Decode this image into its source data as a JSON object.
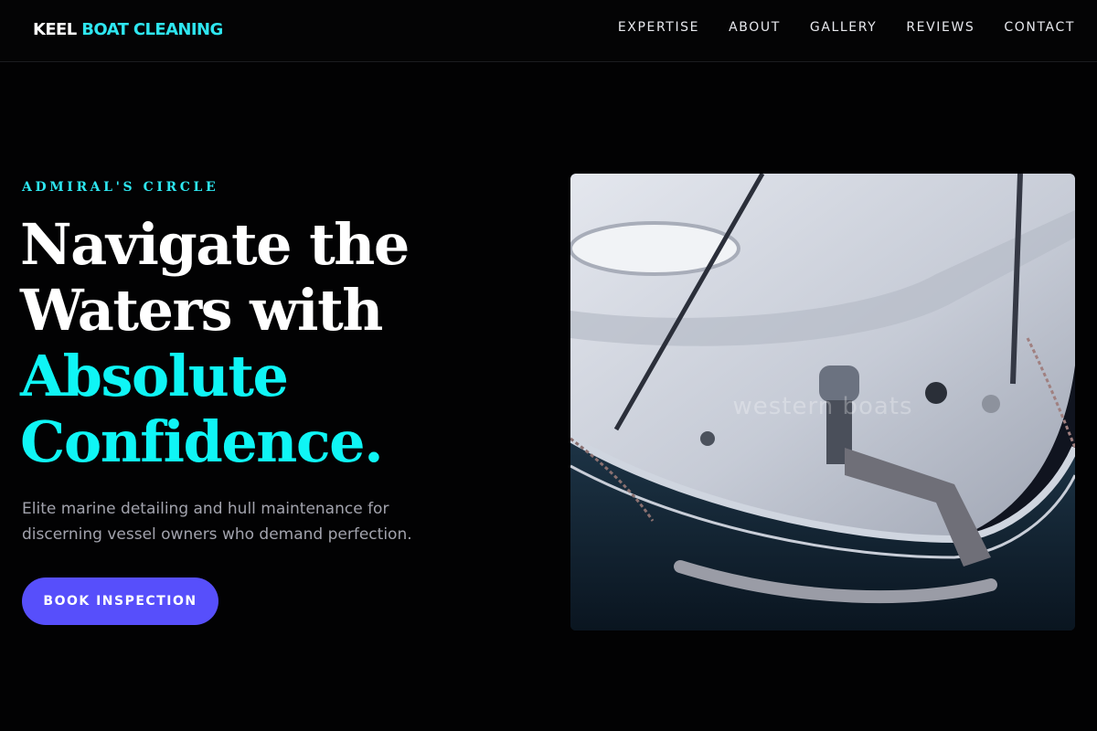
{
  "header": {
    "logo_word": "KEEL",
    "logo_accent": "BOAT CLEANING",
    "nav": [
      "EXPERTISE",
      "ABOUT",
      "GALLERY",
      "REVIEWS",
      "CONTACT"
    ]
  },
  "hero": {
    "eyebrow": "ADMIRAL'S CIRCLE",
    "headline_lines": [
      "Navigate the",
      "Waters with",
      "Absolute",
      "Confidence."
    ],
    "lead_lines": [
      "Elite marine detailing and hull maintenance for",
      "discerning vessel owners who demand perfection."
    ],
    "cta_label": "BOOK INSPECTION",
    "image_watermark": "western boats"
  },
  "colors": {
    "background": "#020203",
    "accent_cyan": "#2ee6f0",
    "headline_cyan": "#0ff5f5",
    "cta": "#574ffb",
    "lead_text": "#a2a3ad"
  },
  "icons": {
    "hero_image": "boat-bow-photo"
  }
}
